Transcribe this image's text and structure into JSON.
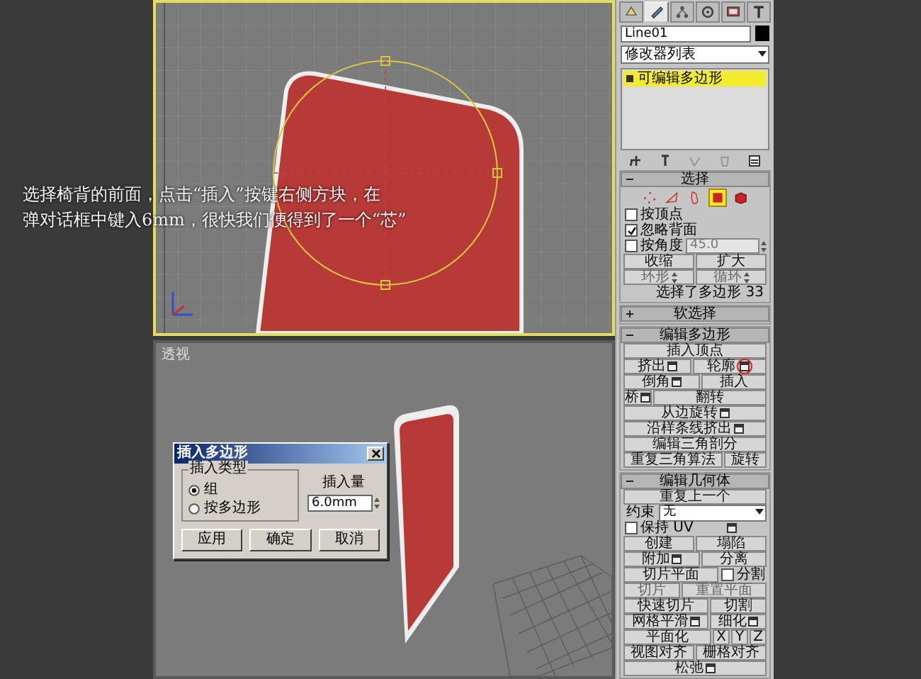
{
  "caption": {
    "lines": [
      "选择椅背的前面，点击“插入”按键右侧方块，在",
      "弹对话框中键入6mm，很快我们便得到了一个“芯”"
    ]
  },
  "top_viewport": {
    "active": true
  },
  "bottom_viewport": {
    "label": "透视",
    "active": false
  },
  "dialog": {
    "title": "插入多边形",
    "group_title": "插入类型",
    "radios": [
      {
        "label": "组",
        "selected": true
      },
      {
        "label": "按多边形",
        "selected": false
      }
    ],
    "amount_label": "插入量",
    "amount_value": "6.0mm",
    "buttons": [
      "应用",
      "确定",
      "取消"
    ]
  },
  "command_panel": {
    "tabs": [
      {
        "selected": false
      },
      {
        "selected": true
      },
      {
        "selected": false
      },
      {
        "selected": false
      },
      {
        "selected": false
      },
      {
        "selected": false
      }
    ],
    "object_name": "Line01",
    "modifier_list": "修改器列表",
    "stack": [
      {
        "label": "可编辑多边形",
        "selected": true
      }
    ],
    "rollouts": [
      {
        "title": "选择",
        "expanded": true,
        "rows": [
          {
            "kind": "subobjects",
            "items": [
              {
                "selected": false
              },
              {
                "selected": false
              },
              {
                "selected": false
              },
              {
                "selected": true
              },
              {
                "selected": false
              }
            ]
          },
          {
            "kind": "controls",
            "items": [
              {
                "kind": "check",
                "label": "按顶点",
                "checked": false
              }
            ]
          },
          {
            "kind": "controls",
            "items": [
              {
                "kind": "check",
                "label": "忽略背面",
                "checked": true
              }
            ]
          },
          {
            "kind": "controls",
            "items": [
              {
                "kind": "check",
                "label": "按角度",
                "checked": false,
                "value": "45.0"
              }
            ]
          },
          {
            "kind": "controls",
            "items": [
              {
                "kind": "button",
                "label": "收缩",
                "settings": false,
                "disabled": false
              },
              {
                "kind": "button",
                "label": "扩大",
                "settings": false,
                "disabled": false
              }
            ]
          },
          {
            "kind": "controls",
            "items": [
              {
                "kind": "button",
                "label": "环形",
                "settings": false,
                "disabled": true,
                "spinner": true
              },
              {
                "kind": "button",
                "label": "循环",
                "settings": false,
                "disabled": true,
                "spinner": true
              }
            ]
          },
          {
            "kind": "text",
            "text": "选择了多边形 33"
          }
        ]
      },
      {
        "title": "软选择",
        "expanded": false
      },
      {
        "title": "编辑多边形",
        "expanded": true,
        "rows": [
          {
            "kind": "controls",
            "items": [
              {
                "kind": "button",
                "label": "插入顶点",
                "settings": false,
                "disabled": false
              }
            ]
          },
          {
            "kind": "controls",
            "items": [
              {
                "kind": "button",
                "label": "挤出",
                "settings": true,
                "disabled": false
              },
              {
                "kind": "button",
                "label": "轮廓",
                "settings": true,
                "disabled": false,
                "circled": true
              }
            ]
          },
          {
            "kind": "controls",
            "items": [
              {
                "kind": "button",
                "label": "倒角",
                "settings": true,
                "disabled": false
              },
              {
                "kind": "button",
                "label": "插入",
                "settings": false,
                "disabled": false
              }
            ]
          },
          {
            "kind": "controls",
            "items": [
              {
                "kind": "button",
                "label": "桥",
                "settings": true,
                "disabled": false
              },
              {
                "kind": "button",
                "label": "翻转",
                "settings": false,
                "disabled": false
              }
            ]
          },
          {
            "kind": "controls",
            "items": [
              {
                "kind": "button",
                "label": "从边旋转",
                "settings": true,
                "disabled": false
              }
            ]
          },
          {
            "kind": "controls",
            "items": [
              {
                "kind": "button",
                "label": "沿样条线挤出",
                "settings": true,
                "disabled": false
              }
            ]
          },
          {
            "kind": "controls",
            "items": [
              {
                "kind": "button",
                "label": "编辑三角剖分",
                "settings": false,
                "disabled": false
              }
            ]
          },
          {
            "kind": "controls",
            "items": [
              {
                "kind": "button",
                "label": "重复三角算法",
                "settings": false,
                "disabled": false
              },
              {
                "kind": "button",
                "label": "旋转",
                "settings": false,
                "disabled": false
              }
            ]
          }
        ]
      },
      {
        "title": "编辑几何体",
        "expanded": true,
        "rows": [
          {
            "kind": "controls",
            "items": [
              {
                "kind": "button",
                "label": "重复上一个",
                "settings": false,
                "disabled": false
              }
            ]
          },
          {
            "kind": "controls",
            "items": [
              {
                "kind": "dropdown",
                "label": "约束",
                "value": "无"
              }
            ]
          },
          {
            "kind": "controls",
            "items": [
              {
                "kind": "check",
                "label": "保持 UV",
                "checked": false,
                "settings": true
              }
            ]
          },
          {
            "kind": "controls",
            "items": [
              {
                "kind": "button",
                "label": "创建",
                "settings": false,
                "disabled": false
              },
              {
                "kind": "button",
                "label": "塌陷",
                "settings": false,
                "disabled": false
              }
            ]
          },
          {
            "kind": "controls",
            "items": [
              {
                "kind": "button",
                "label": "附加",
                "settings": true,
                "disabled": false
              },
              {
                "kind": "button",
                "label": "分离",
                "settings": false,
                "disabled": false
              }
            ]
          },
          {
            "kind": "controls",
            "items": [
              {
                "kind": "button",
                "label": "切片平面",
                "settings": false,
                "disabled": false
              },
              {
                "kind": "check",
                "label": "分割",
                "checked": false
              }
            ]
          },
          {
            "kind": "controls",
            "items": [
              {
                "kind": "button",
                "label": "切片",
                "settings": false,
                "disabled": true
              },
              {
                "kind": "button",
                "label": "重置平面",
                "settings": false,
                "disabled": true
              }
            ]
          },
          {
            "kind": "controls",
            "items": [
              {
                "kind": "button",
                "label": "快速切片",
                "settings": false,
                "disabled": false
              },
              {
                "kind": "button",
                "label": "切割",
                "settings": false,
                "disabled": false
              }
            ]
          },
          {
            "kind": "controls",
            "items": [
              {
                "kind": "button",
                "label": "网格平滑",
                "settings": true,
                "disabled": false
              },
              {
                "kind": "button",
                "label": "细化",
                "settings": true,
                "disabled": false
              }
            ]
          },
          {
            "kind": "controls",
            "items": [
              {
                "kind": "button",
                "label": "平面化",
                "settings": false,
                "disabled": false
              },
              {
                "kind": "button",
                "label": "X",
                "settings": false,
                "disabled": false
              },
              {
                "kind": "button",
                "label": "Y",
                "settings": false,
                "disabled": false
              },
              {
                "kind": "button",
                "label": "Z",
                "settings": false,
                "disabled": false
              }
            ]
          },
          {
            "kind": "controls",
            "items": [
              {
                "kind": "button",
                "label": "视图对齐",
                "settings": false,
                "disabled": false
              },
              {
                "kind": "button",
                "label": "栅格对齐",
                "settings": false,
                "disabled": false
              }
            ]
          },
          {
            "kind": "controls",
            "items": [
              {
                "kind": "button",
                "label": "松弛",
                "settings": true,
                "disabled": false
              }
            ]
          }
        ]
      }
    ]
  }
}
